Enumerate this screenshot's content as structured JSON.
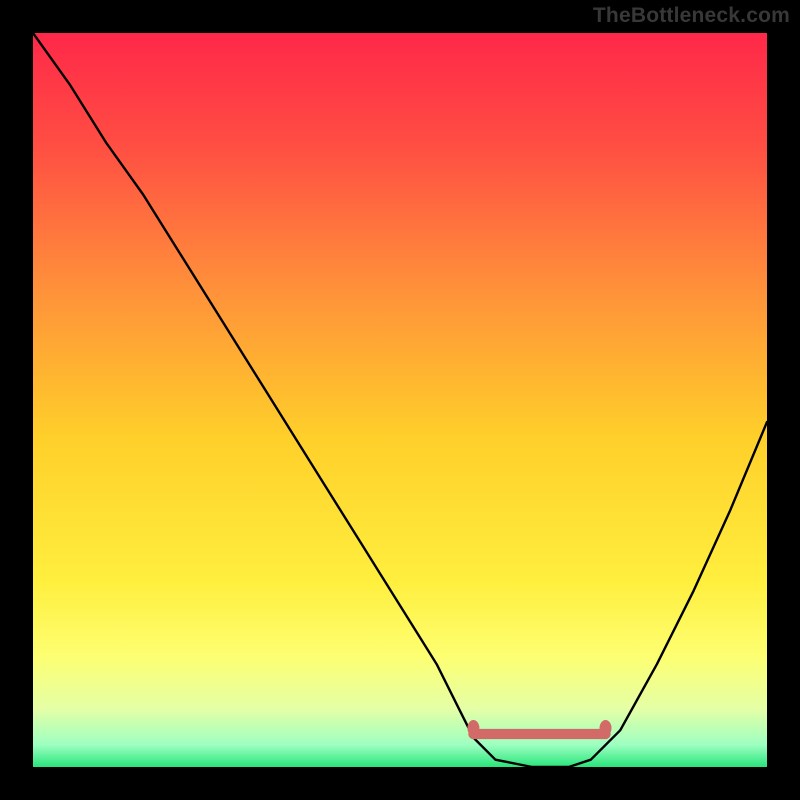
{
  "watermark": "TheBottleneck.com",
  "chart_data": {
    "type": "line",
    "title": "",
    "xlabel": "",
    "ylabel": "",
    "xlim": [
      0,
      100
    ],
    "ylim": [
      0,
      100
    ],
    "grid": false,
    "legend": false,
    "series": [
      {
        "name": "bottleneck-curve",
        "x": [
          0,
          5,
          10,
          15,
          20,
          25,
          30,
          35,
          40,
          45,
          50,
          55,
          58,
          60,
          63,
          68,
          73,
          76,
          80,
          85,
          90,
          95,
          100
        ],
        "values": [
          100,
          93,
          85,
          78,
          70,
          62,
          54,
          46,
          38,
          30,
          22,
          14,
          8,
          4,
          1,
          0,
          0,
          1,
          5,
          14,
          24,
          35,
          47
        ]
      }
    ],
    "optimal_band": {
      "x_start": 60,
      "x_end": 78,
      "y": 4.5,
      "thickness": 4,
      "color": "#d26b67"
    },
    "gradient_stops": [
      {
        "offset": 0.0,
        "color": "#ff2849"
      },
      {
        "offset": 0.15,
        "color": "#ff4d43"
      },
      {
        "offset": 0.35,
        "color": "#ff913a"
      },
      {
        "offset": 0.55,
        "color": "#ffcf2a"
      },
      {
        "offset": 0.75,
        "color": "#ffef3f"
      },
      {
        "offset": 0.85,
        "color": "#fdff72"
      },
      {
        "offset": 0.92,
        "color": "#e5ffa6"
      },
      {
        "offset": 0.97,
        "color": "#9dffc1"
      },
      {
        "offset": 1.0,
        "color": "#28e57a"
      }
    ]
  }
}
